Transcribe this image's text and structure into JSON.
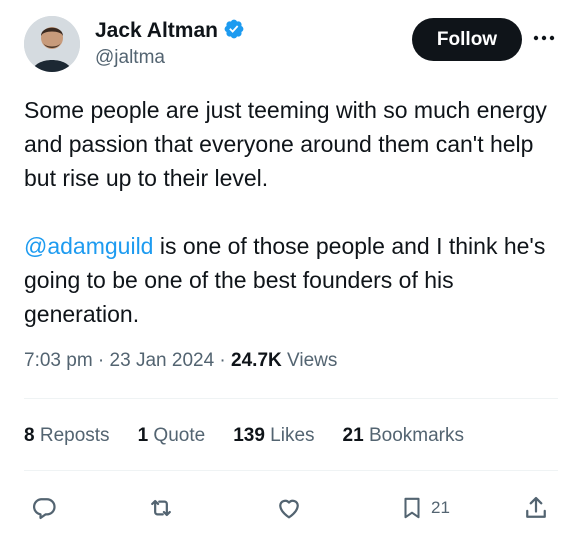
{
  "author": {
    "name": "Jack Altman",
    "handle": "@jaltma",
    "verified": true,
    "verified_color": "#1d9bf0"
  },
  "follow_button": {
    "label": "Follow"
  },
  "more_button": {
    "icon": "more-horizontal-icon"
  },
  "tweet": {
    "paragraph1": "Some people are just teeming with so much energy and passion that everyone around them can't help but rise up to their level.",
    "mention": "@adamguild",
    "paragraph2_rest": " is one of those people and I think he's going to be one of the best founders of his generation."
  },
  "meta": {
    "time": "7:03 pm",
    "separator": " · ",
    "date": "23 Jan 2024",
    "views_count": "24.7K",
    "views_label": " Views"
  },
  "stats": [
    {
      "count": "8",
      "label": " Reposts"
    },
    {
      "count": "1",
      "label": " Quote"
    },
    {
      "count": "139",
      "label": " Likes"
    },
    {
      "count": "21",
      "label": " Bookmarks"
    }
  ],
  "actions": {
    "reply": {
      "icon": "reply-icon"
    },
    "repost": {
      "icon": "repost-icon"
    },
    "like": {
      "icon": "heart-icon"
    },
    "bookmark": {
      "icon": "bookmark-icon",
      "count": "21"
    },
    "share": {
      "icon": "share-icon"
    }
  },
  "colors": {
    "text_primary": "#0f1419",
    "text_secondary": "#536471",
    "link": "#1d9bf0",
    "button_bg": "#0f1419",
    "divider": "#eff3f4"
  }
}
